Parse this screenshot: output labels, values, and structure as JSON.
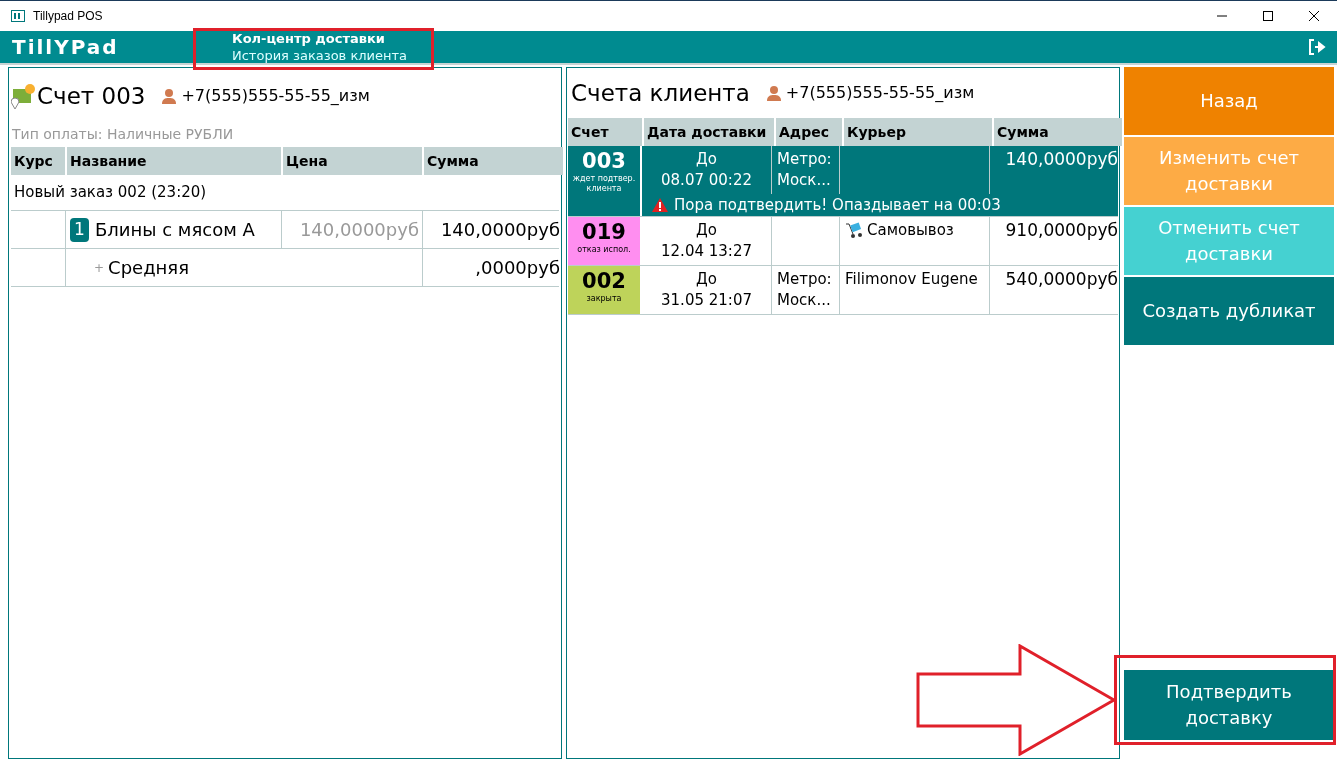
{
  "window": {
    "title": "Tillypad POS"
  },
  "header": {
    "logo": "TillYPad",
    "title": "Кол-центр доставки",
    "subtitle": "История заказов клиента"
  },
  "order": {
    "title": "Счет 003",
    "client": "+7(555)555-55-55_изм",
    "payment": "Тип оплаты: Наличные РУБЛИ",
    "columns": [
      "Курс",
      "Название",
      "Цена",
      "Сумма"
    ],
    "group": "Новый заказ 002 (23:20)",
    "items": [
      {
        "kind": "dish",
        "qty": "1",
        "name": "Блины с мясом А",
        "price": "140,0000руб",
        "sum": "140,0000руб"
      },
      {
        "kind": "modifier",
        "qty": "+",
        "name": "Средняя",
        "sum": ",0000руб"
      }
    ]
  },
  "accounts": {
    "title": "Счета клиента",
    "client": "+7(555)555-55-55_изм",
    "columns": [
      "Счет",
      "Дата доставки",
      "Адрес",
      "Курьер",
      "Сумма"
    ],
    "rows": [
      {
        "number": "003",
        "status": "ждет подтвер. клиента",
        "color": "#00777b",
        "selected": true,
        "date_prefix": "До",
        "date": "08.07 00:22",
        "address": "Метро: Моск...",
        "sum": "140,0000руб",
        "warning": "Пора подтвердить! Опаздывает на 00:03"
      },
      {
        "number": "019",
        "status": "отказ испол.",
        "color": "#ff8ef0",
        "selected": false,
        "date_prefix": "До",
        "date": "12.04 13:27",
        "courier": "Самовывоз",
        "kind": "pickup",
        "sum": "910,0000руб"
      },
      {
        "number": "002",
        "status": "закрыта",
        "color": "#bed35a",
        "selected": false,
        "date_prefix": "До",
        "date": "31.05 21:07",
        "address": "Метро: Моск...",
        "courier": "Filimonov Eugene",
        "sum": "540,0000руб"
      }
    ]
  },
  "actions": [
    {
      "label": "Назад",
      "color": "#ef8200"
    },
    {
      "label": "Изменить счет доставки",
      "color": "#fdab45"
    },
    {
      "label": "Отменить счет доставки",
      "color": "#45d1d1"
    },
    {
      "label": "Создать дубликат",
      "color": "#00777b"
    }
  ],
  "confirm_button": {
    "label": "Подтвердить доставку",
    "color": "#00777b"
  }
}
